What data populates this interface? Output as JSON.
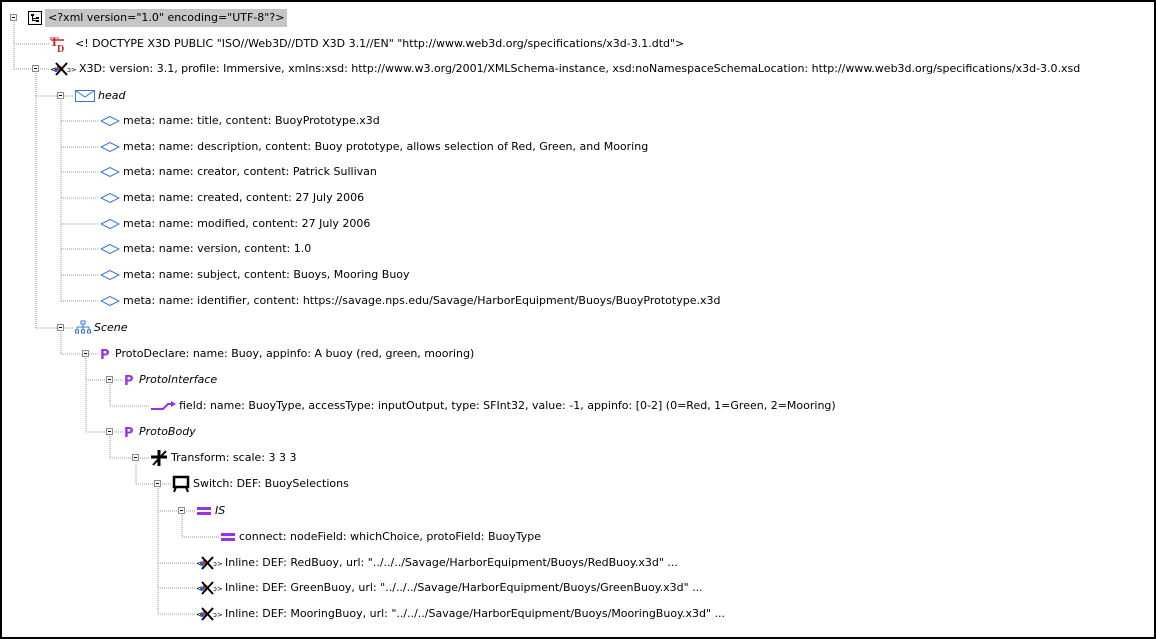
{
  "tree": {
    "nodes": [
      {
        "id": "xmldecl",
        "text": "<?xml version=\"1.0\" encoding=\"UTF-8\"?>",
        "icon": "document-tree-icon",
        "toggle": true,
        "selected": true
      },
      {
        "id": "doctype",
        "text": "<! DOCTYPE X3D PUBLIC \"ISO//Web3D//DTD X3D 3.1//EN\"  \"http://www.web3d.org/specifications/x3d-3.1.dtd\">",
        "icon": "dtd-icon",
        "toggle": false
      },
      {
        "id": "x3d",
        "text": "X3D:  version: 3.1,  profile: Immersive,  xmlns:xsd: http://www.w3.org/2001/XMLSchema-instance,  xsd:noNamespaceSchemaLocation: http://www.web3d.org/specifications/x3d-3.0.xsd",
        "icon": "x3d-icon",
        "toggle": true
      },
      {
        "id": "head",
        "text": "head",
        "icon": "envelope-icon",
        "toggle": true,
        "italic": true
      },
      {
        "id": "meta1",
        "text": "meta:  name: title,  content: BuoyPrototype.x3d",
        "icon": "diamond-icon"
      },
      {
        "id": "meta2",
        "text": "meta:  name: description,  content: Buoy prototype, allows selection of Red, Green, and Mooring",
        "icon": "diamond-icon"
      },
      {
        "id": "meta3",
        "text": "meta:  name: creator,  content: Patrick Sullivan",
        "icon": "diamond-icon"
      },
      {
        "id": "meta4",
        "text": "meta:  name: created,  content: 27 July 2006",
        "icon": "diamond-icon"
      },
      {
        "id": "meta5",
        "text": "meta:  name: modified,  content: 27 July 2006",
        "icon": "diamond-icon"
      },
      {
        "id": "meta6",
        "text": "meta:  name: version,  content: 1.0",
        "icon": "diamond-icon"
      },
      {
        "id": "meta7",
        "text": "meta:  name: subject,  content: Buoys, Mooring Buoy",
        "icon": "diamond-icon"
      },
      {
        "id": "meta8",
        "text": "meta:  name: identifier,  content: https://savage.nps.edu/Savage/HarborEquipment/Buoys/BuoyPrototype.x3d",
        "icon": "diamond-icon"
      },
      {
        "id": "scene",
        "text": "Scene",
        "icon": "scene-graph-icon",
        "toggle": true,
        "italic": true
      },
      {
        "id": "protodeclare",
        "text": "ProtoDeclare:  name: Buoy,  appinfo: A buoy (red, green, mooring)",
        "icon": "proto-p-icon",
        "toggle": true
      },
      {
        "id": "protointerface",
        "text": "ProtoInterface",
        "icon": "proto-p-icon",
        "toggle": true,
        "italic": true
      },
      {
        "id": "field",
        "text": "field:  name: BuoyType,  accessType: inputOutput,  type: SFInt32,  value: -1,  appinfo: [0-2] (0=Red, 1=Green, 2=Mooring)",
        "icon": "field-arrow-icon"
      },
      {
        "id": "protobody",
        "text": "ProtoBody",
        "icon": "proto-p-icon",
        "toggle": true,
        "italic": true
      },
      {
        "id": "transform",
        "text": "Transform:  scale: 3 3 3",
        "icon": "transform-icon",
        "toggle": true
      },
      {
        "id": "switch",
        "text": "Switch:  DEF: BuoySelections",
        "icon": "switch-icon",
        "toggle": true
      },
      {
        "id": "is",
        "text": "IS",
        "icon": "is-equals-icon",
        "toggle": true,
        "italic": true
      },
      {
        "id": "connect",
        "text": "connect:  nodeField: whichChoice,  protoField: BuoyType",
        "icon": "is-equals-icon"
      },
      {
        "id": "inline1",
        "text": "Inline:  DEF: RedBuoy,  url: \"../../../Savage/HarborEquipment/Buoys/RedBuoy.x3d\" ...",
        "icon": "x3d-icon"
      },
      {
        "id": "inline2",
        "text": "Inline:  DEF: GreenBuoy,  url: \"../../../Savage/HarborEquipment/Buoys/GreenBuoy.x3d\" ...",
        "icon": "x3d-icon"
      },
      {
        "id": "inline3",
        "text": "Inline:  DEF: MooringBuoy,  url: \"../../../Savage/HarborEquipment/Buoys/MooringBuoy.x3d\" ...",
        "icon": "x3d-icon"
      }
    ]
  },
  "colors": {
    "selection": "#c6c6c6",
    "dotted_line": "#9a9a9a",
    "proto_purple": "#9b30e6",
    "envelope_blue": "#3478d6",
    "dtd_red": "#c0282c"
  }
}
